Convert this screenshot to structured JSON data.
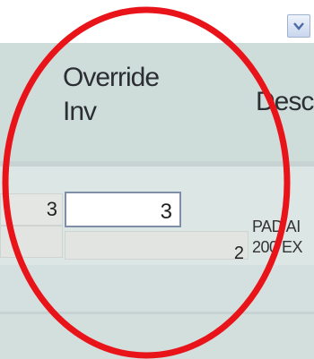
{
  "columns": {
    "override_line1": "Override",
    "override_line2": "Inv",
    "description_partial": "Desc"
  },
  "row": {
    "current_qty": "3",
    "override_value": "3",
    "sub_qty": "2",
    "description_line1": "PAD AI",
    "description_line2": "200 EX"
  },
  "dropdown": {
    "icon": "chevron-down-icon"
  },
  "colors": {
    "annotation": "#e8141a",
    "header_bg": "#cedcda",
    "row_bg": "#dce7e5"
  }
}
